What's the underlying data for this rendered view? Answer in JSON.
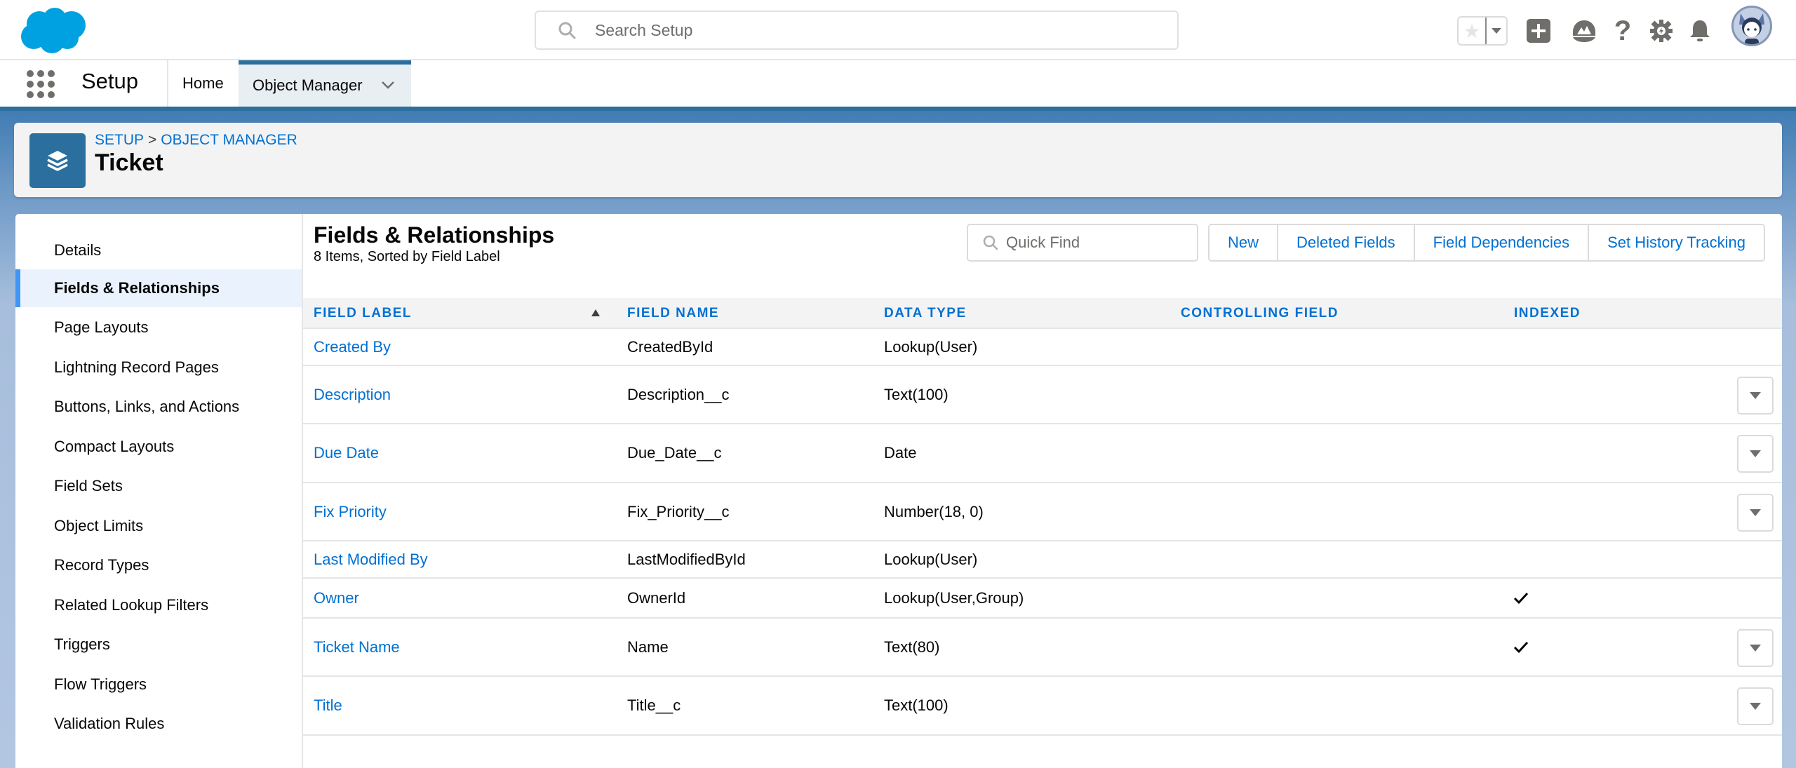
{
  "global_header": {
    "search_placeholder": "Search Setup",
    "icons": [
      "salesforce-cloud-logo",
      "favorites-star-icon",
      "favorites-dropdown-icon",
      "global-actions-plus-icon",
      "trailhead-icon",
      "help-icon",
      "setup-gear-icon",
      "notifications-bell-icon",
      "user-avatar"
    ]
  },
  "context_nav": {
    "app_name": "Setup",
    "tabs": [
      {
        "label": "Home",
        "active": false
      },
      {
        "label": "Object Manager",
        "active": true
      }
    ]
  },
  "object_header": {
    "breadcrumb": [
      "SETUP",
      "OBJECT MANAGER"
    ],
    "breadcrumb_separator": ">",
    "title": "Ticket"
  },
  "sidebar": {
    "items": [
      {
        "label": "Details"
      },
      {
        "label": "Fields & Relationships",
        "active": true
      },
      {
        "label": "Page Layouts"
      },
      {
        "label": "Lightning Record Pages"
      },
      {
        "label": "Buttons, Links, and Actions"
      },
      {
        "label": "Compact Layouts"
      },
      {
        "label": "Field Sets"
      },
      {
        "label": "Object Limits"
      },
      {
        "label": "Record Types"
      },
      {
        "label": "Related Lookup Filters"
      },
      {
        "label": "Triggers"
      },
      {
        "label": "Flow Triggers"
      },
      {
        "label": "Validation Rules"
      }
    ]
  },
  "main": {
    "title": "Fields & Relationships",
    "subtitle": "8 Items, Sorted by Field Label",
    "quick_find_placeholder": "Quick Find",
    "buttons": [
      "New",
      "Deleted Fields",
      "Field Dependencies",
      "Set History Tracking"
    ],
    "table": {
      "columns": [
        "FIELD LABEL",
        "FIELD NAME",
        "DATA TYPE",
        "CONTROLLING FIELD",
        "INDEXED"
      ],
      "sorted_by": "FIELD LABEL",
      "sort_direction": "ascending",
      "rows": [
        {
          "label": "Created By",
          "name": "CreatedById",
          "type": "Lookup(User)",
          "controlling": "",
          "indexed": false,
          "has_menu": false
        },
        {
          "label": "Description",
          "name": "Description__c",
          "type": "Text(100)",
          "controlling": "",
          "indexed": false,
          "has_menu": true
        },
        {
          "label": "Due Date",
          "name": "Due_Date__c",
          "type": "Date",
          "controlling": "",
          "indexed": false,
          "has_menu": true
        },
        {
          "label": "Fix Priority",
          "name": "Fix_Priority__c",
          "type": "Number(18, 0)",
          "controlling": "",
          "indexed": false,
          "has_menu": true
        },
        {
          "label": "Last Modified By",
          "name": "LastModifiedById",
          "type": "Lookup(User)",
          "controlling": "",
          "indexed": false,
          "has_menu": false
        },
        {
          "label": "Owner",
          "name": "OwnerId",
          "type": "Lookup(User,Group)",
          "controlling": "",
          "indexed": true,
          "has_menu": false
        },
        {
          "label": "Ticket Name",
          "name": "Name",
          "type": "Text(80)",
          "controlling": "",
          "indexed": true,
          "has_menu": true
        },
        {
          "label": "Title",
          "name": "Title__c",
          "type": "Text(100)",
          "controlling": "",
          "indexed": false,
          "has_menu": true
        }
      ]
    }
  },
  "colors": {
    "brand_blue": "#0070d2",
    "object_icon": "#2a6f9e",
    "active_nav_bar": "#4196f5",
    "salesforce_cloud": "#00a1e0"
  }
}
